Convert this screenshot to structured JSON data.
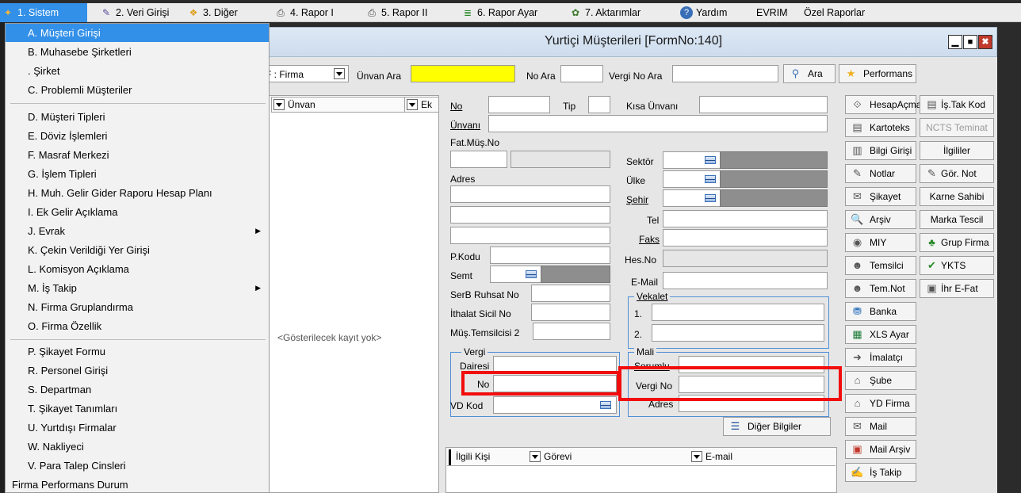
{
  "menubar": {
    "items": [
      {
        "label": "1. Sistem",
        "icon": "system-icon"
      },
      {
        "label": "2. Veri Girişi",
        "icon": "data-entry-icon"
      },
      {
        "label": "3. Diğer",
        "icon": "other-icon"
      },
      {
        "label": "4. Rapor I",
        "icon": "printer-icon"
      },
      {
        "label": "5. Rapor II",
        "icon": "printer-icon"
      },
      {
        "label": "6. Rapor Ayar",
        "icon": "report-settings-icon"
      },
      {
        "label": "7. Aktarımlar",
        "icon": "transfer-icon"
      },
      {
        "label": "Yardım",
        "icon": "help-icon"
      },
      {
        "label": "EVRIM",
        "icon": ""
      },
      {
        "label": "Özel Raporlar",
        "icon": ""
      }
    ]
  },
  "sistem_menu": {
    "items": [
      "A. Müşteri Girişi",
      "B. Muhasebe Şirketleri",
      ". Şirket",
      "C. Problemli Müşteriler",
      "D. Müşteri Tipleri",
      "E. Döviz İşlemleri",
      "F. Masraf Merkezi",
      "G. İşlem Tipleri",
      "H. Muh. Gelir Gider Raporu Hesap Planı",
      "I. Ek Gelir Açıklama",
      "J. Evrak",
      "K. Çekin Verildiği Yer Girişi",
      "L. Komisyon Açıklama",
      "M. İş Takip",
      "N. Firma Gruplandırma",
      "O. Firma Özellik",
      "P. Şikayet Formu",
      "R. Personel Girişi",
      "S. Departman",
      "T. Şikayet Tanımları",
      "U. Yurtdışı Firmalar",
      "W. Nakliyeci",
      "V. Para Talep Cinsleri",
      "Firma Performans Durum"
    ]
  },
  "form": {
    "title": "Yurtiçi Müşterileri [FormNo:140]",
    "window_buttons": {
      "minimize": "▁",
      "maximize": "■",
      "close": "✖"
    },
    "search": {
      "filter_value": "F : Firma",
      "unvan_ara_label": "Ünvan Ara",
      "no_ara_label": "No Ara",
      "vergi_no_ara_label": "Vergi No Ara",
      "ara_button": "Ara",
      "performans_button": "Performans"
    },
    "list": {
      "col_unvan": "Ünvan",
      "col_ek": "Ek",
      "empty_text": "<Gösterilecek kayıt yok>"
    },
    "fields": {
      "no": "No",
      "tip": "Tip",
      "kisa_unvan": "Kısa Ünvanı",
      "unvani": "Ünvanı",
      "fat_mus_no": "Fat.Müş.No",
      "adres": "Adres",
      "sektor": "Sektör",
      "ulke": "Ülke",
      "sehir": "Şehir",
      "tel": "Tel",
      "faks": "Faks",
      "p_kodu": "P.Kodu",
      "hes_no": "Hes.No",
      "semt": "Semt",
      "e_mail": "E-Mail",
      "serb_ruhsat": "SerB Ruhsat No",
      "ithalat_sicil": "İthalat Sicil No",
      "mus_temsilci2": "Müş.Temsilcisi 2",
      "vekalet": "Vekalet",
      "vekalet_1": "1.",
      "vekalet_2": "2.",
      "vergi_group": "Vergi",
      "dairesi": "Dairesi",
      "vergi_no_small": "No",
      "vd_kod": "VD Kod",
      "mali_group": "Mali",
      "sorumlu": "Sorumlu",
      "vergi_no": "Vergi No",
      "mali_adres": "Adres",
      "diger_bilgiler": "Diğer Bilgiler"
    },
    "contacts": {
      "col_kisi": "İlgili Kişi",
      "col_gorevi": "Görevi",
      "col_email": "E-mail"
    },
    "side_buttons_a": [
      {
        "label": "HesapAçma",
        "icon": "account-icon"
      },
      {
        "label": "Kartoteks",
        "icon": "cardfile-icon"
      },
      {
        "label": "Bilgi Girişi",
        "icon": "info-icon"
      },
      {
        "label": "Notlar",
        "icon": "notes-icon"
      },
      {
        "label": "Şikayet",
        "icon": "complaint-icon"
      },
      {
        "label": "Arşiv",
        "icon": "archive-icon"
      },
      {
        "label": "MIY",
        "icon": "miy-icon"
      },
      {
        "label": "Temsilci",
        "icon": "representative-icon"
      },
      {
        "label": "Tem.Not",
        "icon": "representative-note-icon"
      },
      {
        "label": "Banka",
        "icon": "bank-icon"
      },
      {
        "label": "XLS Ayar",
        "icon": "excel-icon"
      },
      {
        "label": "İmalatçı",
        "icon": "manufacturer-icon"
      },
      {
        "label": "Şube",
        "icon": "branch-icon"
      },
      {
        "label": "YD Firma",
        "icon": "foreign-firm-icon"
      },
      {
        "label": "Mail",
        "icon": "mail-icon"
      },
      {
        "label": "Mail Arşiv",
        "icon": "mail-archive-icon"
      },
      {
        "label": "İş Takip",
        "icon": "task-icon"
      }
    ],
    "side_buttons_b": [
      {
        "label": "İş.Tak Kod",
        "icon": "task-code-icon"
      },
      {
        "label": "NCTS Teminat",
        "icon": ""
      },
      {
        "label": "İlgililer",
        "icon": ""
      },
      {
        "label": "Gör. Not",
        "icon": "view-note-icon"
      },
      {
        "label": "Karne Sahibi",
        "icon": ""
      },
      {
        "label": "Marka Tescil",
        "icon": ""
      },
      {
        "label": "Grup Firma",
        "icon": "group-firm-icon"
      },
      {
        "label": "YKTS",
        "icon": "check-icon"
      },
      {
        "label": "İhr E-Fat",
        "icon": "export-invoice-icon"
      }
    ]
  },
  "colors": {
    "highlight": "#3390e8",
    "search_field": "#ffff00",
    "annotation_box": "#f20d0d"
  }
}
